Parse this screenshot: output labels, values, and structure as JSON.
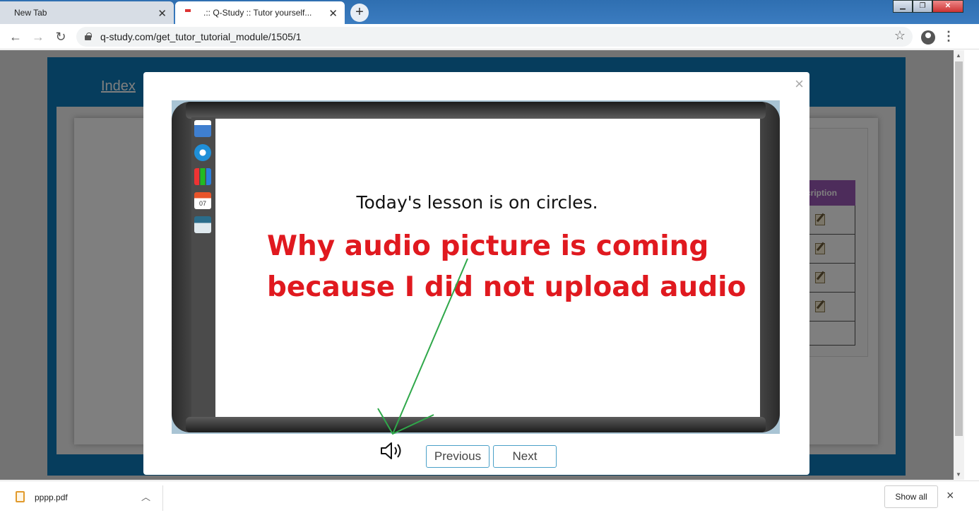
{
  "browser": {
    "tabs": [
      {
        "label": "New Tab"
      },
      {
        "label": ".:: Q-Study :: Tutor yourself..."
      }
    ],
    "url": "q-study.com/get_tutor_tutorial_module/1505/1",
    "icons": {
      "back": "back-arrow-icon",
      "forward": "forward-arrow-icon",
      "reload": "reload-icon",
      "lock": "lock-icon",
      "star": "star-icon",
      "account": "account-icon",
      "menu": "menu-icon"
    }
  },
  "page": {
    "index_link": "Index",
    "table_header": "cription",
    "edit_rows": 4,
    "colors": {
      "banner": "#0c7bbb",
      "header": "#9b59b6"
    }
  },
  "modal": {
    "close_label": "×",
    "lesson_text": "Today's lesson is on circles.",
    "annotation": "Why audio picture is coming because I did not upload audio",
    "annotation_color": "#e0191f",
    "buttons": {
      "previous": "Previous",
      "next": "Next"
    },
    "speaker_icon": "speaker-icon"
  },
  "downloads": {
    "file": "pppp.pdf",
    "show_all": "Show all",
    "close_label": "×"
  }
}
